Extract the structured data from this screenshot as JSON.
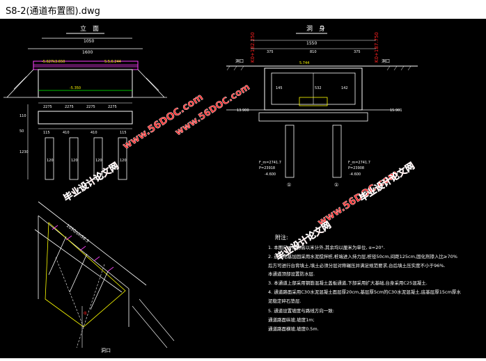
{
  "window": {
    "title": "S8-2(通道布置图).dwg"
  },
  "elevation": {
    "title": "立　面",
    "dim_total": "1050",
    "dim_top": "1600",
    "lvl_left": "-5.627k3.650",
    "lvl_right": "5.5,6.244",
    "lvl_bottom": "-5.350",
    "dims_lower": [
      "2275",
      "2275",
      "2275",
      "2275"
    ],
    "dims_footing": [
      "115",
      "410",
      "410",
      "115"
    ],
    "pile_labels": [
      "120",
      "120",
      "120",
      "120"
    ],
    "side_dims": [
      "110",
      "50",
      "1230"
    ]
  },
  "section": {
    "title": "洞　身",
    "dim_total": "1550",
    "dims_top": [
      "375",
      "810",
      "375"
    ],
    "label_left": "洞口",
    "label_right": "洞口",
    "stake_left": "K0+182.250",
    "stake_right": "K0+187.750",
    "lvl_road": "5.744",
    "lvl_left": "13.900",
    "lvl_right": "15.901",
    "pile_lvl_left": [
      "F_m=2741.7",
      "P=23918",
      "-4.600"
    ],
    "pile_lvl_right": [
      "F_m=2741.7",
      "P=23908",
      "-4.600"
    ],
    "circle_labels": [
      "①",
      "①"
    ],
    "dim_labels": [
      "145",
      "532",
      "142"
    ]
  },
  "plan": {
    "dim_label": "1050/sin56.5",
    "angle": "α",
    "entry": "洞口"
  },
  "notes": {
    "title": "附注:",
    "lines": [
      "1. 本图尺寸除标高以米计外,其余均以厘米为单位, α=20°.",
      "2. 通道地基加固采用水泥搅拌桩,桩端进入持力层,桩径50cm,间距125cm,固化剂掺入比≥70%",
      "   后方可进行台背填土,填土必须分层对称碾压并满足规范要求,台后填土压实度不小于96%.",
      "   本通道顶部设置防水层.",
      "3. 本通道上部采用钢筋混凝土盖板通道,下部采用扩大基础,台身采用C25混凝土.",
      "4. 通道路面采用C30水泥混凝土面层厚20cm,基层厚5cm的C30水泥混凝土,底基层厚15cm厚水",
      "   泥稳定碎石垫层.",
      "5. 通道设置坡度与路线方向一致:",
      "   通道路面纵坡,坡度1m;",
      "   通道路面横坡,坡度0.5m."
    ]
  },
  "watermarks": [
    "www.56DOC.com",
    "毕业设计论文网",
    "www.56DOC.com",
    "毕业设计论文网",
    "www.56DOC.com",
    "毕业设计论文网"
  ],
  "colors": {
    "background": "#000000",
    "lines": "#ffffff",
    "cyan": "#00ffff",
    "yellow": "#ffff00",
    "red": "#ff2020",
    "magenta": "#ff40ff",
    "green": "#00ff00"
  }
}
